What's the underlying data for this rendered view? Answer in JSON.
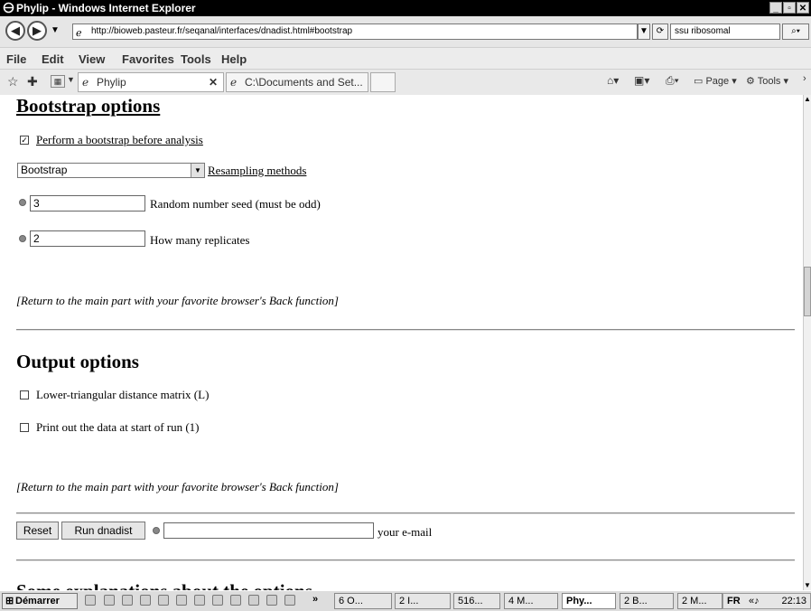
{
  "window": {
    "title": "Phylip - Windows Internet Explorer"
  },
  "address_bar": {
    "url": "http://bioweb.pasteur.fr/seqanal/interfaces/dnadist.html#bootstrap",
    "search_value": "ssu ribosomal"
  },
  "menu": [
    "File",
    "Edit",
    "View",
    "Favorites",
    "Tools",
    "Help"
  ],
  "tabs": [
    {
      "label": "Phylip",
      "active": true
    },
    {
      "label": "C:\\Documents and Set...",
      "active": false
    }
  ],
  "command_bar": {
    "page_label": "Page",
    "tools_label": "Tools"
  },
  "bootstrap": {
    "heading": "Bootstrap options",
    "perform_label": "Perform a bootstrap before analysis",
    "perform_checked": true,
    "method_value": "Bootstrap",
    "method_link": "Resampling methods",
    "seed_value": "3",
    "seed_label": "Random number seed (must be odd)",
    "replicates_value": "2",
    "replicates_label": "How many replicates",
    "return_text": "[Return to the main part with your favorite browser's Back function]"
  },
  "output": {
    "heading": "Output options",
    "lower_triangular_label": "Lower-triangular distance matrix (L)",
    "lower_triangular_checked": false,
    "print_data_label": "Print out the data at start of run (1)",
    "print_data_checked": false,
    "return_text": "[Return to the main part with your favorite browser's Back function]"
  },
  "form_actions": {
    "reset_label": "Reset",
    "run_label": "Run dnadist",
    "email_value": "",
    "email_label": "your e-mail"
  },
  "partial_heading": "Some explanations about the options",
  "taskbar": {
    "start_label": "Démarrer",
    "items": [
      "6 O...",
      "2 I...",
      "516...",
      "4 M...",
      "Phy...",
      "2 B...",
      "2 M..."
    ],
    "clock": "22:13"
  }
}
